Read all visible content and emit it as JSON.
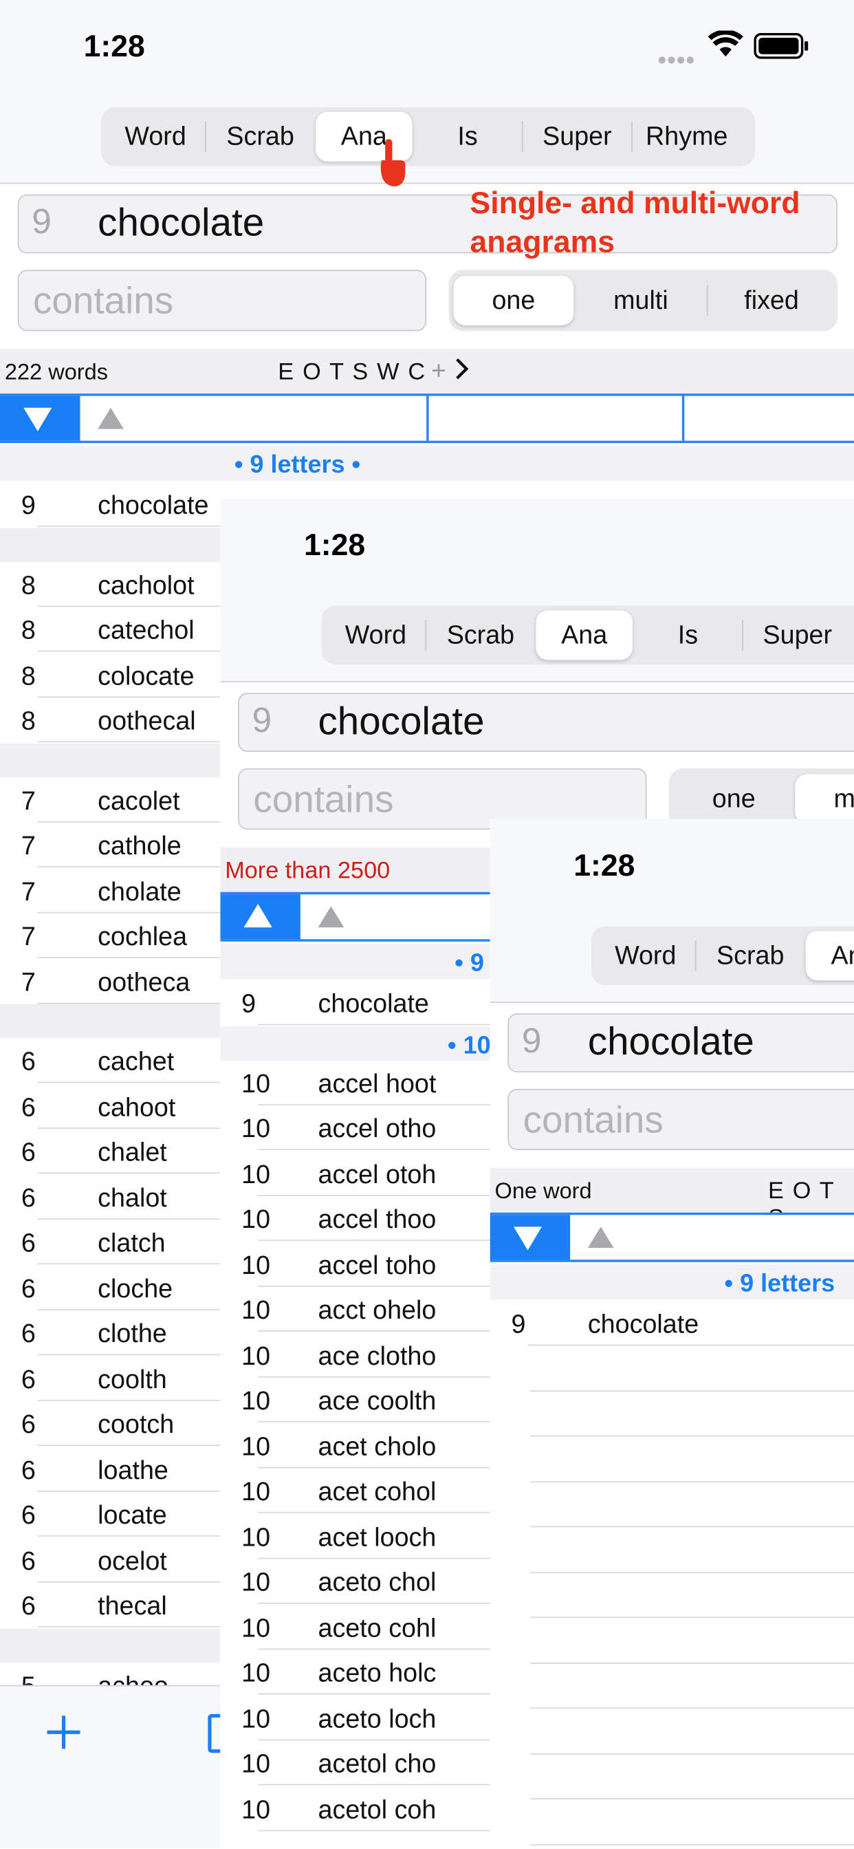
{
  "status": {
    "time": "1:28"
  },
  "tabs": [
    "Word",
    "Scrab",
    "Ana",
    "Is",
    "Super",
    "Rhyme"
  ],
  "selected_tab": "Ana",
  "search": {
    "length": "9",
    "word": "chocolate"
  },
  "contains_placeholder": "contains",
  "mode_segments": [
    "one",
    "multi",
    "fixed"
  ],
  "annotation": "Single- and multi-word anagrams",
  "screen1": {
    "count": "222 words",
    "letters": "E O T S W C",
    "plus": "+",
    "group_header": "• 9 letters •",
    "rows": [
      {
        "n": "9",
        "w": "chocolate"
      },
      {
        "n": "8",
        "w": "cacholot"
      },
      {
        "n": "8",
        "w": "catechol"
      },
      {
        "n": "8",
        "w": "colocate"
      },
      {
        "n": "8",
        "w": "oothecal"
      },
      {
        "n": "7",
        "w": "cacolet"
      },
      {
        "n": "7",
        "w": "cathole"
      },
      {
        "n": "7",
        "w": "cholate"
      },
      {
        "n": "7",
        "w": "cochlea"
      },
      {
        "n": "7",
        "w": "ootheca"
      },
      {
        "n": "6",
        "w": "cachet"
      },
      {
        "n": "6",
        "w": "cahoot"
      },
      {
        "n": "6",
        "w": "chalet"
      },
      {
        "n": "6",
        "w": "chalot"
      },
      {
        "n": "6",
        "w": "clatch"
      },
      {
        "n": "6",
        "w": "cloche"
      },
      {
        "n": "6",
        "w": "clothe"
      },
      {
        "n": "6",
        "w": "coolth"
      },
      {
        "n": "6",
        "w": "cootch"
      },
      {
        "n": "6",
        "w": "loathe"
      },
      {
        "n": "6",
        "w": "locate"
      },
      {
        "n": "6",
        "w": "ocelot"
      },
      {
        "n": "6",
        "w": "thecal"
      },
      {
        "n": "5",
        "w": "achoo"
      }
    ]
  },
  "screen2": {
    "warning": "More than 2500",
    "group_header_a": "• 9",
    "group_header_b": "• 10",
    "rows": [
      {
        "n": "9",
        "w": "chocolate"
      },
      {
        "n": "10",
        "w": "accel hoot"
      },
      {
        "n": "10",
        "w": "accel otho"
      },
      {
        "n": "10",
        "w": "accel otoh"
      },
      {
        "n": "10",
        "w": "accel thoo"
      },
      {
        "n": "10",
        "w": "accel toho"
      },
      {
        "n": "10",
        "w": "acct ohelo"
      },
      {
        "n": "10",
        "w": "ace clotho"
      },
      {
        "n": "10",
        "w": "ace coolth"
      },
      {
        "n": "10",
        "w": "acet cholo"
      },
      {
        "n": "10",
        "w": "acet cohol"
      },
      {
        "n": "10",
        "w": "acet looch"
      },
      {
        "n": "10",
        "w": "aceto chol"
      },
      {
        "n": "10",
        "w": "aceto cohl"
      },
      {
        "n": "10",
        "w": "aceto holc"
      },
      {
        "n": "10",
        "w": "aceto loch"
      },
      {
        "n": "10",
        "w": "acetol cho"
      },
      {
        "n": "10",
        "w": "acetol coh"
      }
    ]
  },
  "screen3": {
    "count": "One word",
    "letters": "E O T S",
    "group_header": "• 9 letters",
    "rows": [
      {
        "n": "9",
        "w": "chocolate"
      }
    ]
  },
  "bottom": {
    "add_label": "+"
  },
  "colors": {
    "accent": "#1a7ff5",
    "annotation": "#e8341c",
    "warning": "#cc1f1a"
  }
}
